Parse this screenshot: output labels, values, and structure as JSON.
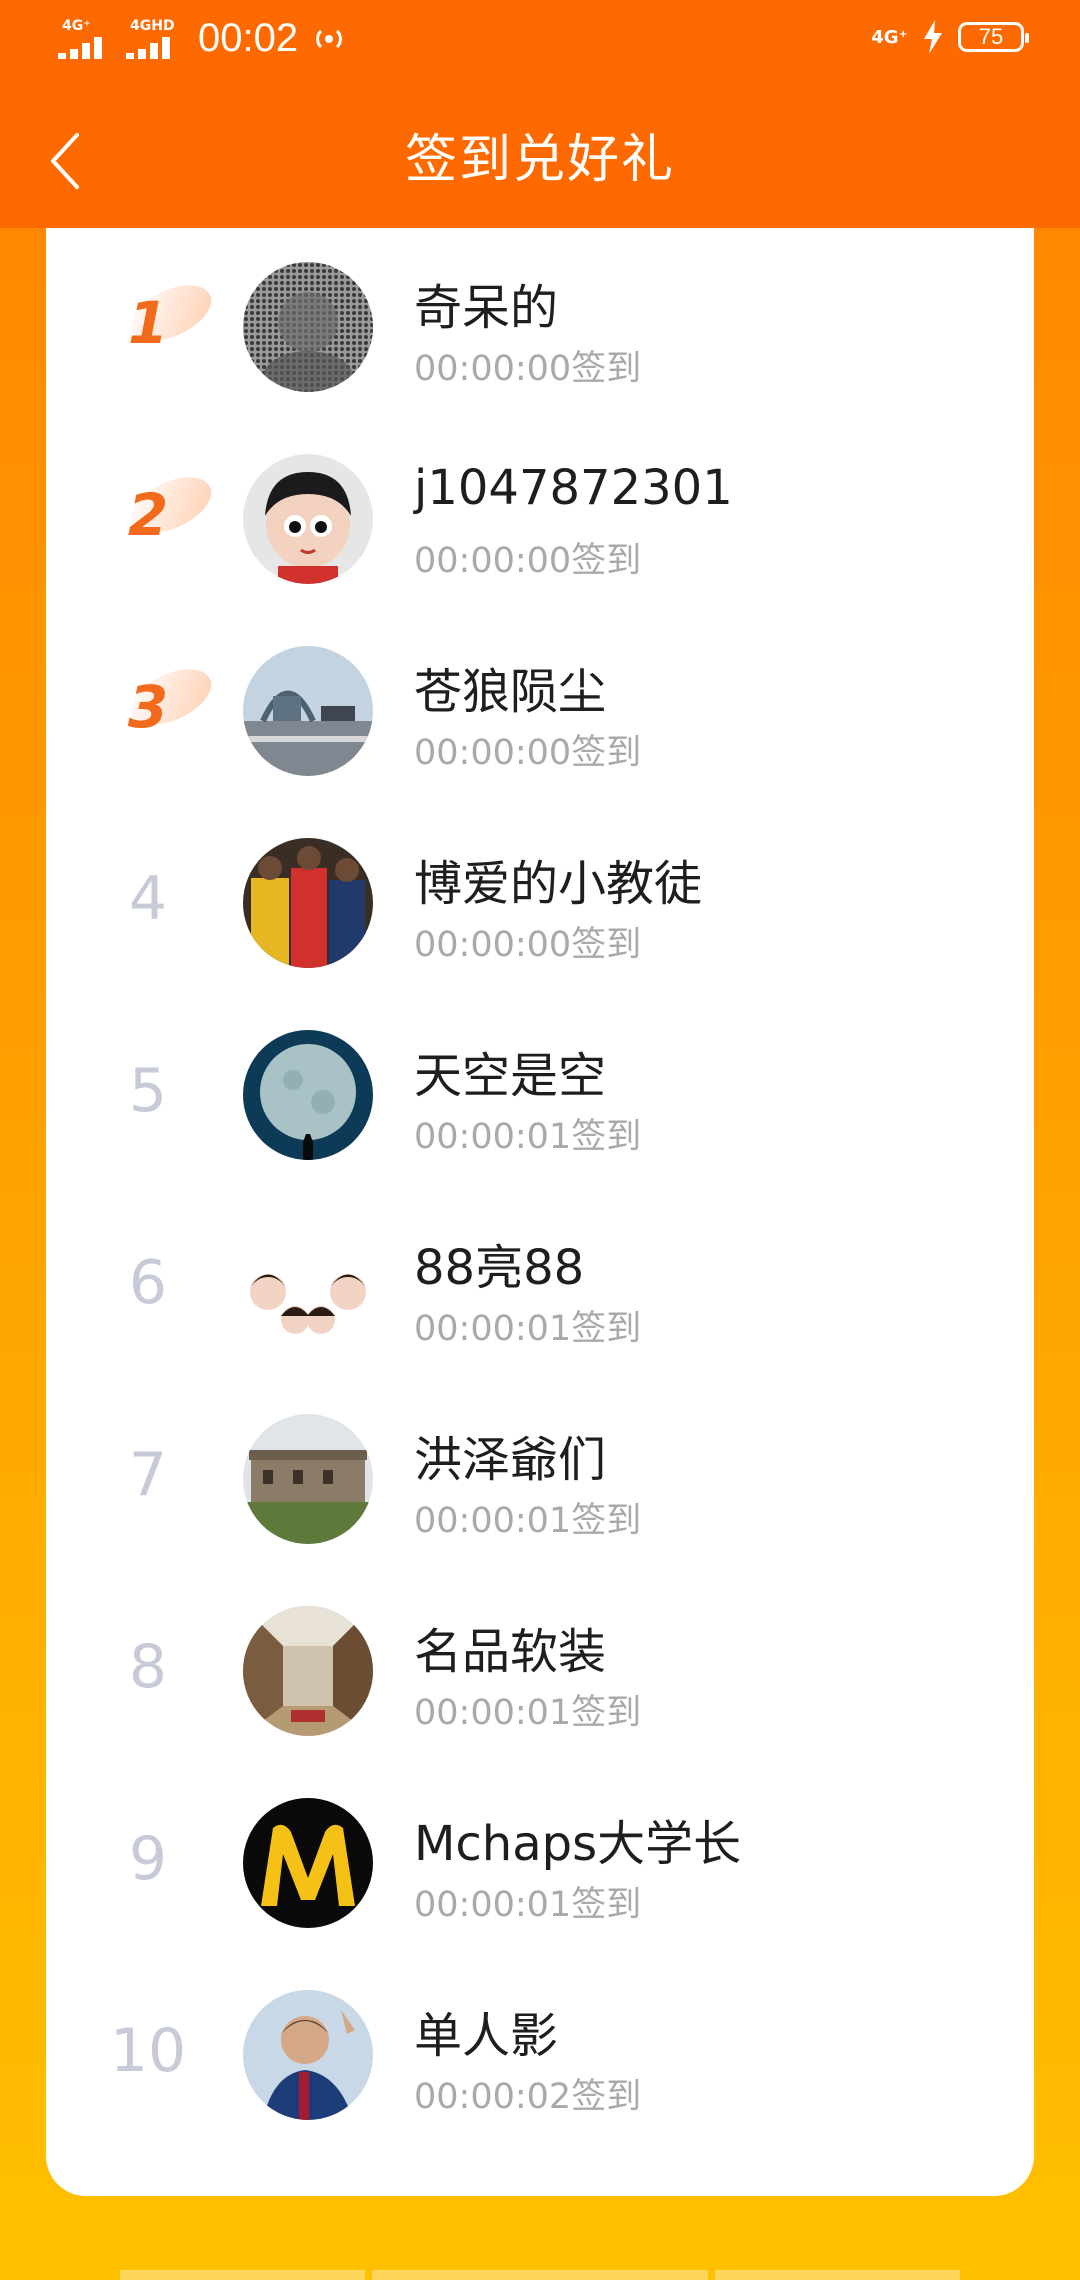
{
  "status_bar": {
    "network_left_1": "4G⁺",
    "network_left_2": "4GHD",
    "time": "00:02",
    "network_right": "4G⁺",
    "battery": "75"
  },
  "header": {
    "title": "签到兑好礼",
    "back_icon": "chevron-left-icon"
  },
  "colors": {
    "header_bg": "#ff6a00",
    "top_rank": "#f26a1b",
    "other_rank": "#c7cad7",
    "name_text": "#1e1e1e",
    "time_text": "#a9a9a9"
  },
  "rank_list": [
    {
      "rank": "1",
      "name": "奇呆的",
      "time": "00:00:00签到"
    },
    {
      "rank": "2",
      "name": "j1047872301",
      "time": "00:00:00签到"
    },
    {
      "rank": "3",
      "name": "苍狼陨尘",
      "time": "00:00:00签到"
    },
    {
      "rank": "4",
      "name": "博爱的小教徒",
      "time": "00:00:00签到"
    },
    {
      "rank": "5",
      "name": "天空是空",
      "time": "00:00:01签到"
    },
    {
      "rank": "6",
      "name": "88亮88",
      "time": "00:00:01签到"
    },
    {
      "rank": "7",
      "name": "洪泽爺们",
      "time": "00:00:01签到"
    },
    {
      "rank": "8",
      "name": "名品软装",
      "time": "00:00:01签到"
    },
    {
      "rank": "9",
      "name": "Mchaps大学长",
      "time": "00:00:01签到"
    },
    {
      "rank": "10",
      "name": "单人影",
      "time": "00:00:02签到"
    }
  ]
}
